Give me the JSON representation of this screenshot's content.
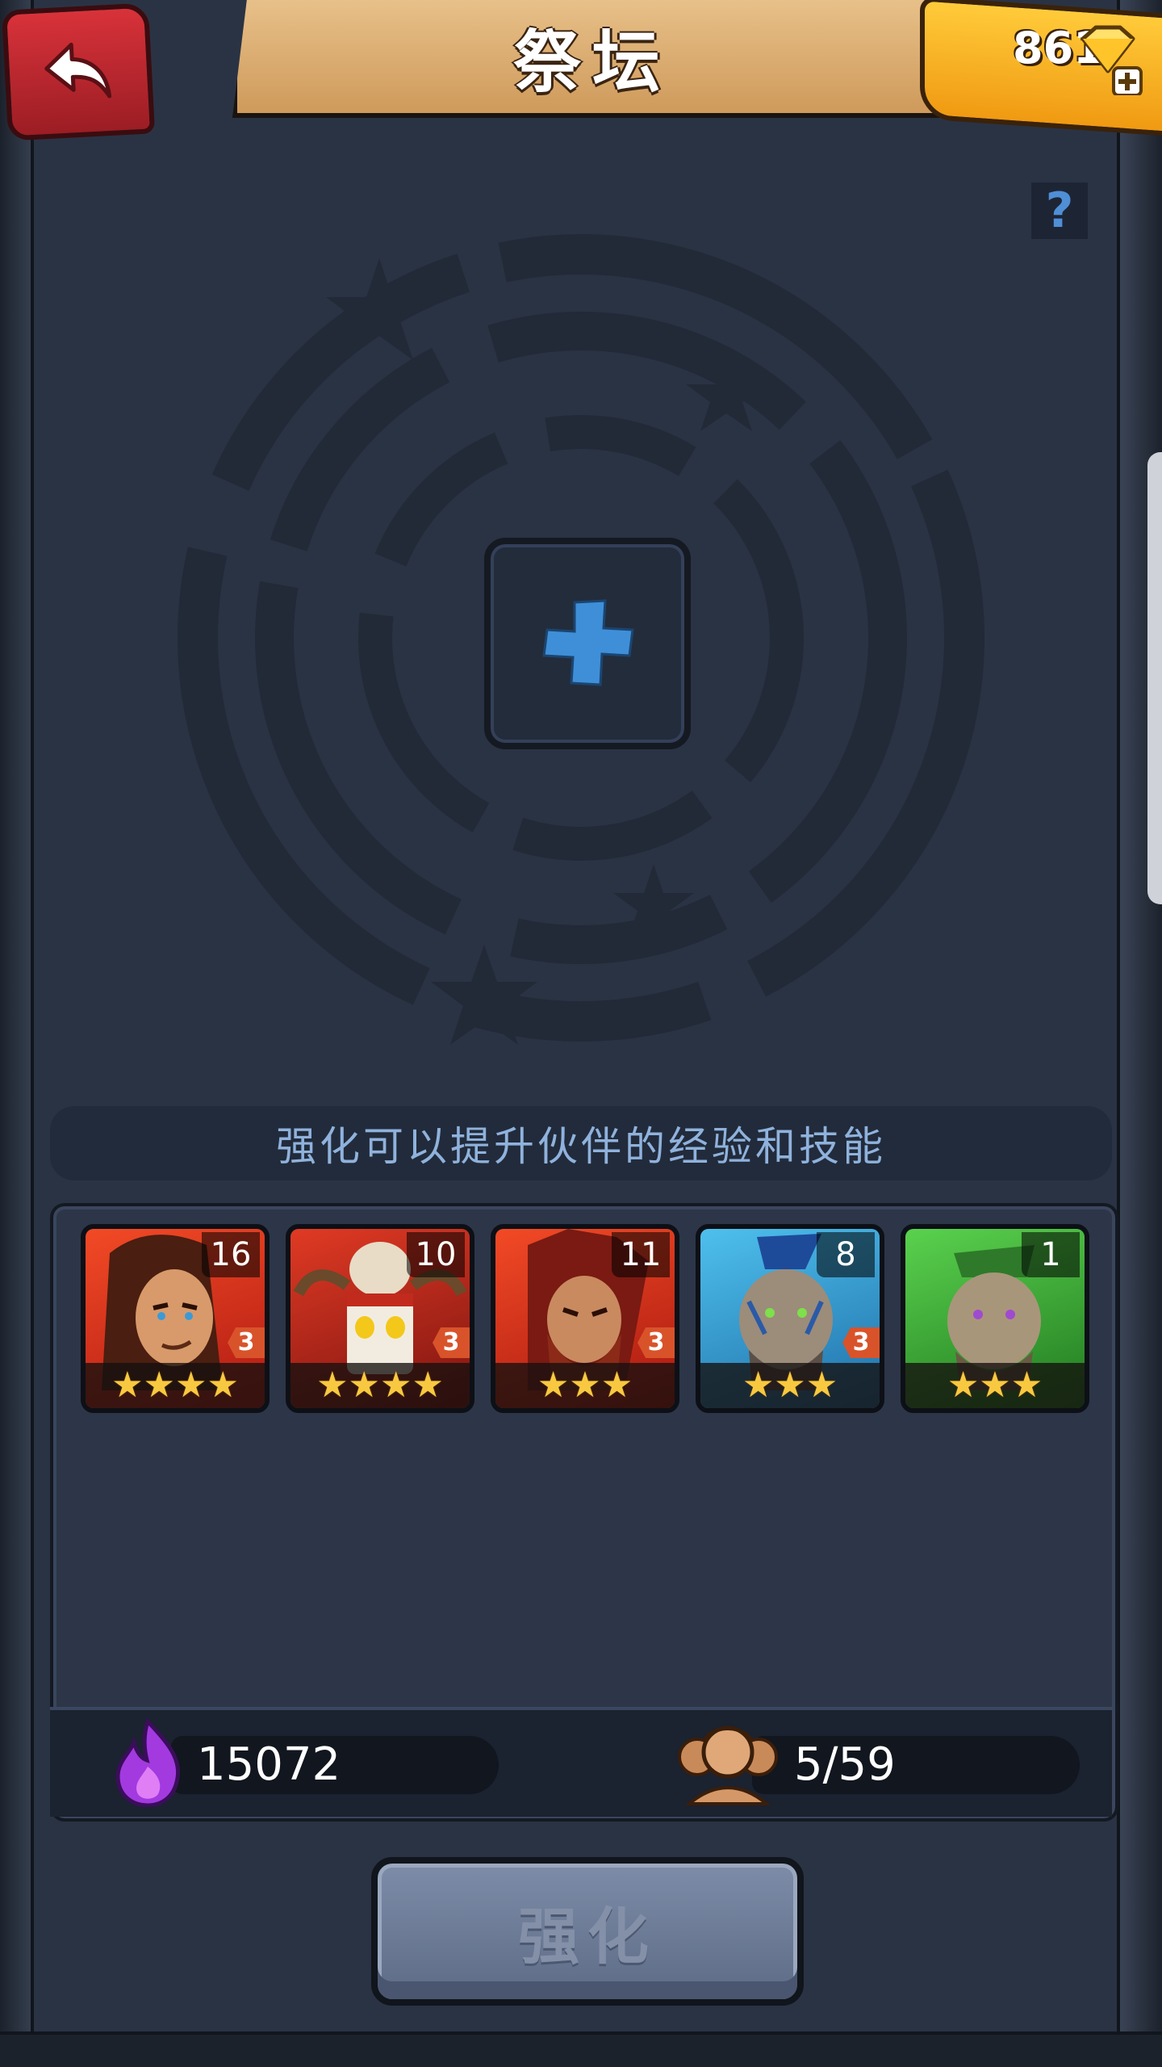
{
  "header": {
    "title": "祭坛",
    "gem_count": "861"
  },
  "help": {
    "label": "?"
  },
  "altar": {
    "slot_label": "+"
  },
  "hint": {
    "text": "强化可以提升伙伴的经验和技能"
  },
  "partners": [
    {
      "level": "16",
      "rank": "3",
      "stars": "★★★★",
      "bg": "#d8261a",
      "face": "long-hair-hero"
    },
    {
      "level": "10",
      "rank": "3",
      "stars": "★★★★",
      "bg": "#b9261e",
      "face": "skull-mask-hero"
    },
    {
      "level": "11",
      "rank": "3",
      "stars": "★★★",
      "bg": "#c8231b",
      "face": "red-beard-hero"
    },
    {
      "level": "8",
      "rank": "3",
      "stars": "★★★",
      "bg": "#2f9ad6",
      "face": "blue-mohawk-hero"
    },
    {
      "level": "1",
      "rank": "",
      "stars": "★★★",
      "bg": "#3bb338",
      "face": "green-hair-hero"
    }
  ],
  "resources": {
    "essence": "15072",
    "partner_count": "5/59"
  },
  "actions": {
    "enhance_label": "强化"
  },
  "colors": {
    "accent_blue": "#4f8fd6",
    "gold": "#f8c940",
    "panel": "#2c3648"
  }
}
